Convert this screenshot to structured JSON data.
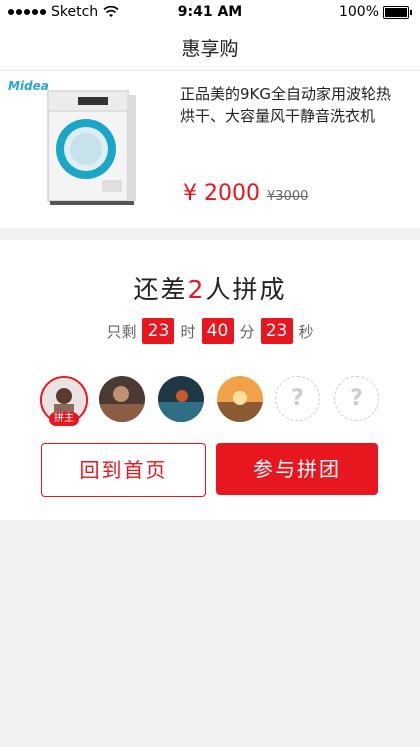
{
  "statusbar": {
    "carrier": "Sketch",
    "time": "9:41 AM",
    "battery": "100%"
  },
  "nav": {
    "title": "惠享购"
  },
  "product": {
    "brand": "Midea",
    "name": "正品美的9KG全自动家用波轮热烘干、大容量风干静音洗衣机",
    "price": "¥ 2000",
    "original_price": "¥3000"
  },
  "group": {
    "need_prefix": "还差",
    "need_count": "2",
    "need_suffix": "人拼成",
    "countdown": {
      "prefix": "只剩",
      "hours": "23",
      "hours_unit": "时",
      "minutes": "40",
      "minutes_unit": "分",
      "seconds": "23",
      "seconds_unit": "秒"
    },
    "leader_tag": "拼主",
    "empty_slot": "?",
    "home_button": "回到首页",
    "join_button": "参与拼团"
  },
  "colors": {
    "accent": "#e8161e",
    "brand_blue": "#2aa4d9"
  }
}
